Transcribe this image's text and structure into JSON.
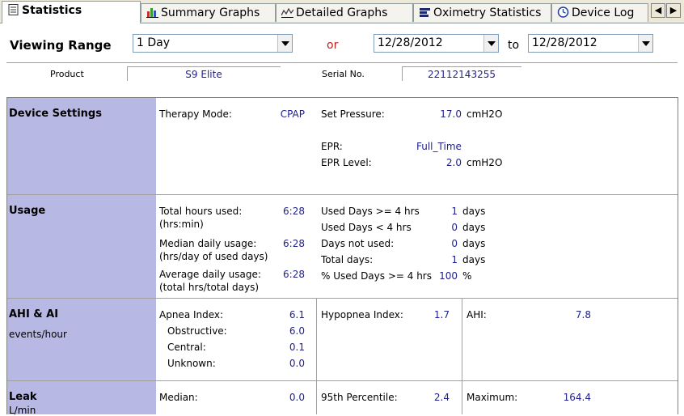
{
  "tabs": [
    {
      "label": "Statistics",
      "icon": "document-icon",
      "active": true
    },
    {
      "label": "Summary Graphs",
      "icon": "bar-graph-icon"
    },
    {
      "label": "Detailed Graphs",
      "icon": "line-graph-icon"
    },
    {
      "label": "Oximetry Statistics",
      "icon": "oximetry-icon"
    },
    {
      "label": "Device Log",
      "icon": "device-log-icon"
    }
  ],
  "viewing": {
    "title": "Viewing Range",
    "range": "1 Day",
    "or": "or",
    "from": "12/28/2012",
    "to_label": "to",
    "to": "12/28/2012"
  },
  "product": {
    "label": "Product",
    "value": "S9 Elite",
    "serial_label": "Serial No.",
    "serial_value": "22112143255"
  },
  "device_settings": {
    "title": "Device Settings",
    "therapy_mode_label": "Therapy Mode:",
    "therapy_mode": "CPAP",
    "set_pressure_label": "Set Pressure:",
    "set_pressure": "17.0",
    "set_pressure_unit": "cmH2O",
    "epr_label": "EPR:",
    "epr": "Full_Time",
    "epr_level_label": "EPR Level:",
    "epr_level": "2.0",
    "epr_level_unit": "cmH2O"
  },
  "usage": {
    "title": "Usage",
    "total_hours_label": "Total hours used:",
    "total_hours_sub": "(hrs:min)",
    "total_hours": "6:28",
    "median_label": "Median daily usage:",
    "median_sub": "(hrs/day of used days)",
    "median": "6:28",
    "average_label": "Average daily usage:",
    "average_sub": "(total hrs/total days)",
    "average": "6:28",
    "right": [
      {
        "label": "Used Days >= 4 hrs",
        "value": "1",
        "unit": "days"
      },
      {
        "label": "Used Days < 4 hrs",
        "value": "0",
        "unit": "days"
      },
      {
        "label": "Days not used:",
        "value": "0",
        "unit": "days"
      },
      {
        "label": "Total days:",
        "value": "1",
        "unit": "days"
      },
      {
        "label": "% Used Days >= 4 hrs",
        "value": "100",
        "unit": "%"
      }
    ]
  },
  "ahi": {
    "title": "AHI & AI",
    "subtitle": "events/hour",
    "apnea_label": "Apnea Index:",
    "apnea": "6.1",
    "obstructive_label": "Obstructive:",
    "obstructive": "6.0",
    "central_label": "Central:",
    "central": "0.1",
    "unknown_label": "Unknown:",
    "unknown": "0.0",
    "hypopnea_label": "Hypopnea Index:",
    "hypopnea": "1.7",
    "ahi_label": "AHI:",
    "ahi": "7.8"
  },
  "leak": {
    "title": "Leak",
    "subtitle": "L/min",
    "median_label": "Median:",
    "median": "0.0",
    "p95_label": "95th Percentile:",
    "p95": "2.4",
    "max_label": "Maximum:",
    "max": "164.4"
  }
}
